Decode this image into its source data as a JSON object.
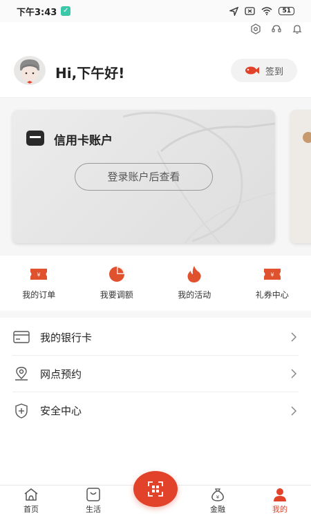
{
  "status_bar": {
    "time": "下午3:43",
    "battery": "51"
  },
  "header": {
    "greeting": "Hi,下午好!",
    "signin_label": "签到"
  },
  "card": {
    "title": "信用卡账户",
    "login_button": "登录账户后查看"
  },
  "quick_actions": [
    {
      "label": "我的订单",
      "icon": "ticket-icon"
    },
    {
      "label": "我要调额",
      "icon": "pie-chart-icon"
    },
    {
      "label": "我的活动",
      "icon": "flame-icon"
    },
    {
      "label": "礼券中心",
      "icon": "coupon-icon"
    }
  ],
  "menu": [
    {
      "label": "我的银行卡",
      "icon": "bank-card-icon"
    },
    {
      "label": "网点预约",
      "icon": "location-pin-icon"
    },
    {
      "label": "安全中心",
      "icon": "shield-icon"
    }
  ],
  "tabs": [
    {
      "label": "首页",
      "icon": "home-icon"
    },
    {
      "label": "生活",
      "icon": "shopping-bag-icon"
    },
    {
      "label": "金融",
      "icon": "money-bag-icon"
    },
    {
      "label": "我的",
      "icon": "person-icon"
    }
  ],
  "colors": {
    "accent": "#e2412a",
    "icon_orange": "#e0512e",
    "card_bg": "#e6e6e6"
  }
}
